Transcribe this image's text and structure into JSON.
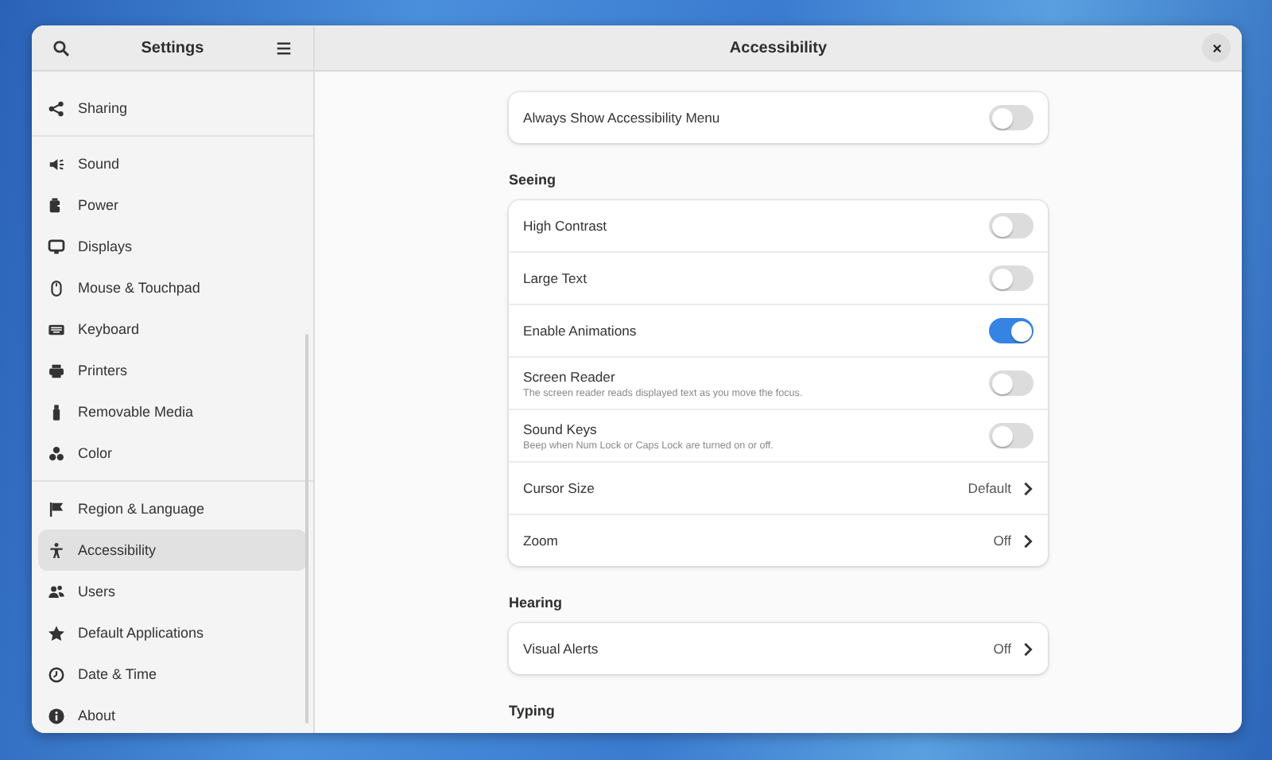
{
  "window": {
    "sidebar_title": "Settings",
    "content_title": "Accessibility"
  },
  "sidebar": {
    "groups": [
      [
        {
          "label": "Sharing",
          "selected": false
        }
      ],
      [
        {
          "label": "Sound",
          "selected": false
        },
        {
          "label": "Power",
          "selected": false
        },
        {
          "label": "Displays",
          "selected": false
        },
        {
          "label": "Mouse & Touchpad",
          "selected": false
        },
        {
          "label": "Keyboard",
          "selected": false
        },
        {
          "label": "Printers",
          "selected": false
        },
        {
          "label": "Removable Media",
          "selected": false
        },
        {
          "label": "Color",
          "selected": false
        }
      ],
      [
        {
          "label": "Region & Language",
          "selected": false
        },
        {
          "label": "Accessibility",
          "selected": true
        },
        {
          "label": "Users",
          "selected": false
        },
        {
          "label": "Default Applications",
          "selected": false
        },
        {
          "label": "Date & Time",
          "selected": false
        },
        {
          "label": "About",
          "selected": false
        }
      ]
    ]
  },
  "sections": [
    {
      "rows": [
        {
          "kind": "switch",
          "label": "Always Show Accessibility Menu",
          "on": false
        }
      ]
    },
    {
      "heading": "Seeing",
      "rows": [
        {
          "kind": "switch",
          "label": "High Contrast",
          "on": false
        },
        {
          "kind": "switch",
          "label": "Large Text",
          "on": false
        },
        {
          "kind": "switch",
          "label": "Enable Animations",
          "on": true
        },
        {
          "kind": "switch",
          "label": "Screen Reader",
          "subtitle": "The screen reader reads displayed text as you move the focus.",
          "on": false
        },
        {
          "kind": "switch",
          "label": "Sound Keys",
          "subtitle": "Beep when Num Lock or Caps Lock are turned on or off.",
          "on": false
        },
        {
          "kind": "value",
          "label": "Cursor Size",
          "value": "Default"
        },
        {
          "kind": "value",
          "label": "Zoom",
          "value": "Off"
        }
      ]
    },
    {
      "heading": "Hearing",
      "rows": [
        {
          "kind": "value",
          "label": "Visual Alerts",
          "value": "Off"
        }
      ]
    },
    {
      "heading": "Typing"
    }
  ]
}
